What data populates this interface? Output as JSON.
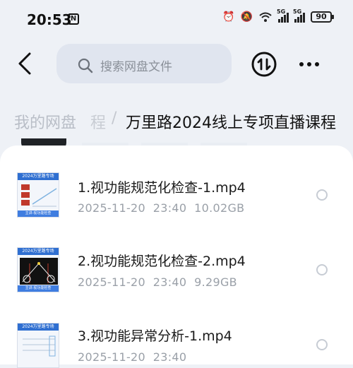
{
  "status_bar": {
    "time": "20:53",
    "nfc_label": "N",
    "net1_label": "5G",
    "net2_label": "5G",
    "battery": "90"
  },
  "search": {
    "placeholder": "搜索网盘文件"
  },
  "breadcrumb": {
    "root": "我的网盘",
    "partial": "程",
    "separator": "/",
    "current": "万里路2024线上专项直播课程"
  },
  "files": [
    {
      "name": "1.视功能规范化检查-1.mp4",
      "date": "2025-11-20",
      "time": "23:40",
      "size": "10.02GB",
      "thumb_title": "2024万里路专场",
      "thumb_footer": "主讲:视功能检查"
    },
    {
      "name": "2.视功能规范化检查-2.mp4",
      "date": "2025-11-20",
      "time": "23:40",
      "size": "9.29GB",
      "thumb_title": "2024万里路专场",
      "thumb_footer": "主讲:视功能检查"
    },
    {
      "name": "3.视功能异常分析-1.mp4",
      "date": "2025-11-20",
      "time": "23:40",
      "size": "",
      "thumb_title": "2024万里路专场",
      "thumb_footer": ""
    }
  ],
  "colors": {
    "background": "#eef1f6",
    "search_bg": "#e0e5ef",
    "thumb_accent": "#2f6fd1",
    "meta_text": "#9aa0a8"
  }
}
